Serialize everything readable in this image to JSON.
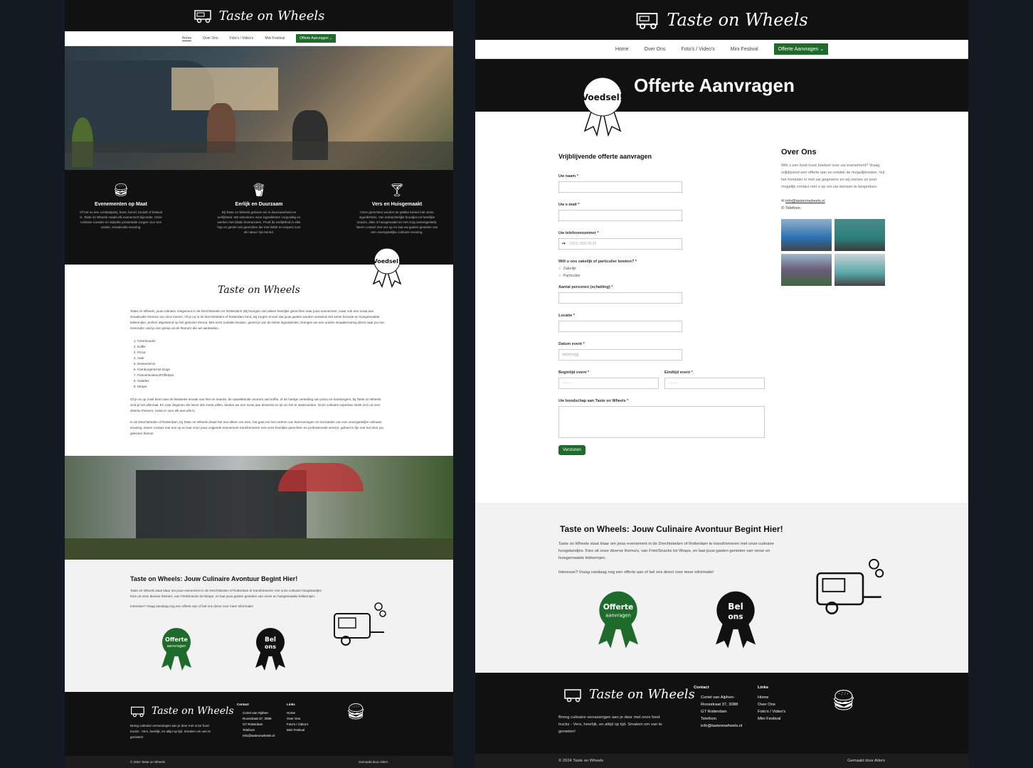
{
  "brand": {
    "name": "Taste on Wheels",
    "accent": "#1f6b2c"
  },
  "nav": {
    "items": [
      "Home",
      "Over Ons",
      "Foto's / Video's",
      "Mini Festival"
    ],
    "cta": "Offerte Aanvragen ⌄"
  },
  "home": {
    "features": [
      {
        "icon": "burger-icon",
        "title": "Evenementen op Maat",
        "text": "Of het nu een cocktailparty, feest, borrel, bruiloft of festival is, Taste on Wheels maakt elk evenement bijzonder. Onze culinaire creaties en stijlvolle presentatie zorgen voor een unieke, smaakvolle ervaring."
      },
      {
        "icon": "fries-icon",
        "title": "Eerlijk en Duurzaam",
        "text": "Bij Taste on Wheels geloven we in duurzaamheid en eerlijkheid. We selecteren onze ingrediënten zorgvuldig en werken met lokale leveranciers. Proef de eerlijkheid in elke hap en geniet van gerechten die met liefde en respect voor de natuur zijn bereid."
      },
      {
        "icon": "cocktail-icon",
        "title": "Vers en Huisgemaakt",
        "text": "Onze gerechten worden ter plekke bereid met verse ingrediënten. Van ambachtelijke broodjes tot heerlijke snacks, alles is huisgemaakt en met zorg samengesteld. Neem contact met ons op en laat uw gasten genieten van een onvergetelijke culinaire ervaring."
      }
    ],
    "badge": "Voedsel!",
    "intro": "Taste on Wheels, jouw culinaire reisgenoot in de Drechtsteden en Rotterdam! Wij brengen niet alleen heerlijke gerechten naar jouw evenement, maar ook een scala aan smaakvolle thema's om uit te kiezen. Of je nu in de Drechtsteden of Rotterdam bent, wij zorgen ervoor dat jouw gasten worden verwend met verse bereide en huisgemaakte lekkernijen, perfect afgestemd op het gekozen thema. Met onze mobiele keuken, geniet je van de beste ingrediënten, brengen we een unieke smaakervaring direct naar jou toe. Hieronder vind je een greep uit de thema's die we aanbieden.",
    "themes": [
      "Friet/Snacks",
      "Koffie",
      "Pizza",
      "Sate",
      "Desserts/IJs",
      "Hamburgers/Hot Dogs",
      "Pannenkoeken/Poffertjes",
      "Salades",
      "Wraps"
    ],
    "para2": "Of je nu op zoek bent naar de klassieke smaak van friet en snacks, de opwekkende aroma's van koffie, of de hartige verleiding van pizza en hamburgers, bij Taste on Wheels vind je het allemaal. En voor degenen die liever iets zoets willen, bieden we een scala aan desserts en ijs om het te waterranden. Onze culinaire expertise strekt zich uit over diverse thema's, zodat er voor elk wat wils is.",
    "para3": "In de Drechtsteden of Rotterdam, bij Taste on Wheels draait het niet alleen om eten; het gaat om het creëren van herinneringen en het bieden van een onvergetelijke culinaire ervaring. Neem contact met ons op en laat onze jouw volgende evenement transformeren met onze heerlijke gerechten en professionele service, geheel in lijn met het door jou gekozen thema!"
  },
  "cta_block": {
    "title": "Taste on Wheels: Jouw Culinaire Avontuur Begint Hier!",
    "text": "Taste on Wheels staat klaar om jouw evenement in de Drechtsteden of Rotterdam te transformeren met onze culinaire hoogstandjes. Kies uit onze diverse thema's, van Friet/Snacks tot Wraps, en laat jouw gasten genieten van verse en huisgemaakte lekkernijen.",
    "text2": "Interesse? Vraag vandaag nog een offerte aan of bel ons direct voor meer informatie!",
    "badge1": [
      "Offerte",
      "aanvragen"
    ],
    "badge2": [
      "Bel",
      "ons"
    ]
  },
  "footer": {
    "tagline": "Breng culinaire verrassingen aan je deur met onze food trucks - Vers, heerlijk, en altijd op tijd. Smaken om van te genieten!",
    "contact_title": "Contact",
    "address1": "Coriet van Alphen-",
    "address2": "Roosstraat 37, 3088",
    "address3": "GT Rotterdam",
    "phone": "Telefoon",
    "email": "info@tasteonwheels.nl",
    "links_title": "Links",
    "links": [
      "Home",
      "Over Ons",
      "Foto's / Video's",
      "Mini Festival"
    ],
    "copyright": "© 2024 Taste on Wheels",
    "made_by": "Gemaakt door Atlers"
  },
  "offerte": {
    "page_title": "Offerte Aanvragen",
    "form_title": "Vrijblijvende offerte aanvragen",
    "fields": {
      "name": "Uw naam",
      "email": "Uw e-mail",
      "phone": "Uw telefoonnummer",
      "phone_placeholder": "(201) 555-0123",
      "type_q": "Wilt u ons zakelijk of particulier boeken?",
      "opt1": "Zakelijk",
      "opt2": "Particulier",
      "persons": "Aantal personen (schatting)",
      "location": "Locatie",
      "date": "Datum event",
      "date_placeholder": "dd/mm/jjjj",
      "start": "Begintijd event",
      "end": "Eindtijd event",
      "time_placeholder": "--:-- --",
      "message": "Uw boodschap aan Taste on Wheels",
      "submit": "Versturen"
    },
    "aside": {
      "title": "Over Ons",
      "text": "Wilt u een food truck boeken voor uw evenement? Vraag vrijblijvend een offerte aan en ontdek de mogelijkheden. Vul het formulier in met uw gegevens en wij nemen zo snel mogelijk contact met u op om uw wensen te bespreken.",
      "email": "info@tasteonwheels.nl",
      "phone": "Telefoon"
    }
  }
}
